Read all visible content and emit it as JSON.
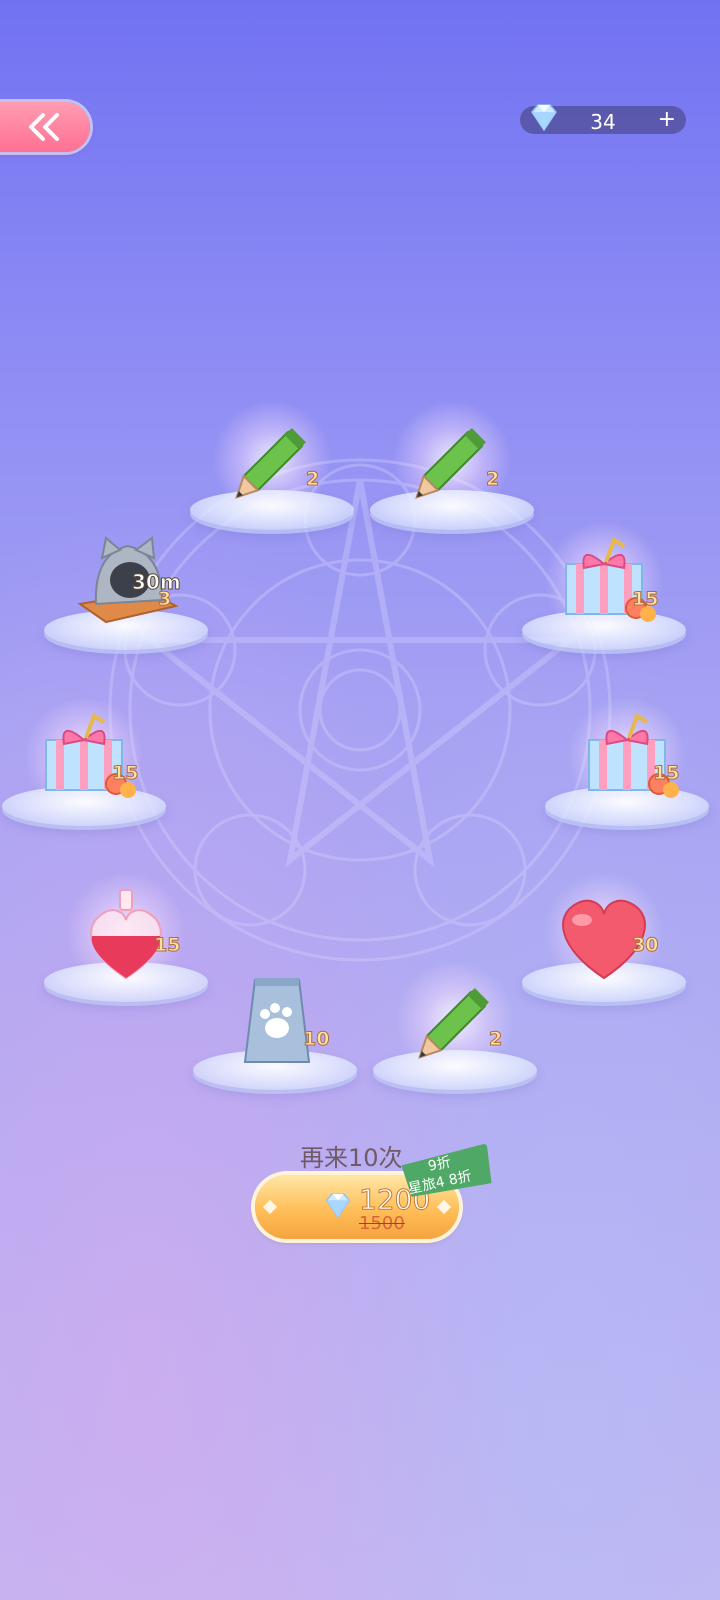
{
  "header": {
    "back_icon": "double-chevron-left-icon",
    "currency": {
      "icon": "diamond-icon",
      "amount": "34",
      "plus_label": "+"
    }
  },
  "rewards": [
    {
      "slot": "pencil-1",
      "icon": "pencil-icon",
      "quantity": "2"
    },
    {
      "slot": "pencil-2",
      "icon": "pencil-icon",
      "quantity": "2"
    },
    {
      "slot": "cat-bed",
      "icon": "cat-bed-icon",
      "duration": "30m",
      "quantity": "3"
    },
    {
      "slot": "gift-1",
      "icon": "gift-box-icon",
      "quantity": "15"
    },
    {
      "slot": "gift-2",
      "icon": "gift-box-icon",
      "quantity": "15"
    },
    {
      "slot": "gift-3",
      "icon": "gift-box-icon",
      "quantity": "15"
    },
    {
      "slot": "potion",
      "icon": "heart-potion-icon",
      "quantity": "15"
    },
    {
      "slot": "heart",
      "icon": "heart-icon",
      "quantity": "30"
    },
    {
      "slot": "food-bag",
      "icon": "paw-food-bag-icon",
      "quantity": "10"
    },
    {
      "slot": "pencil-3",
      "icon": "pencil-icon",
      "quantity": "2"
    }
  ],
  "draw": {
    "label": "再来10次",
    "discount_line1": "9折",
    "discount_line2": "星旅4 8折",
    "price": "1200",
    "original_price": "1500"
  },
  "colors": {
    "bg_top": "#7172f2",
    "bg_bottom": "#c2b6f0",
    "back_button": "#ff6f94",
    "buy_button": "#ffbe58",
    "discount_tag": "#4fa865"
  }
}
